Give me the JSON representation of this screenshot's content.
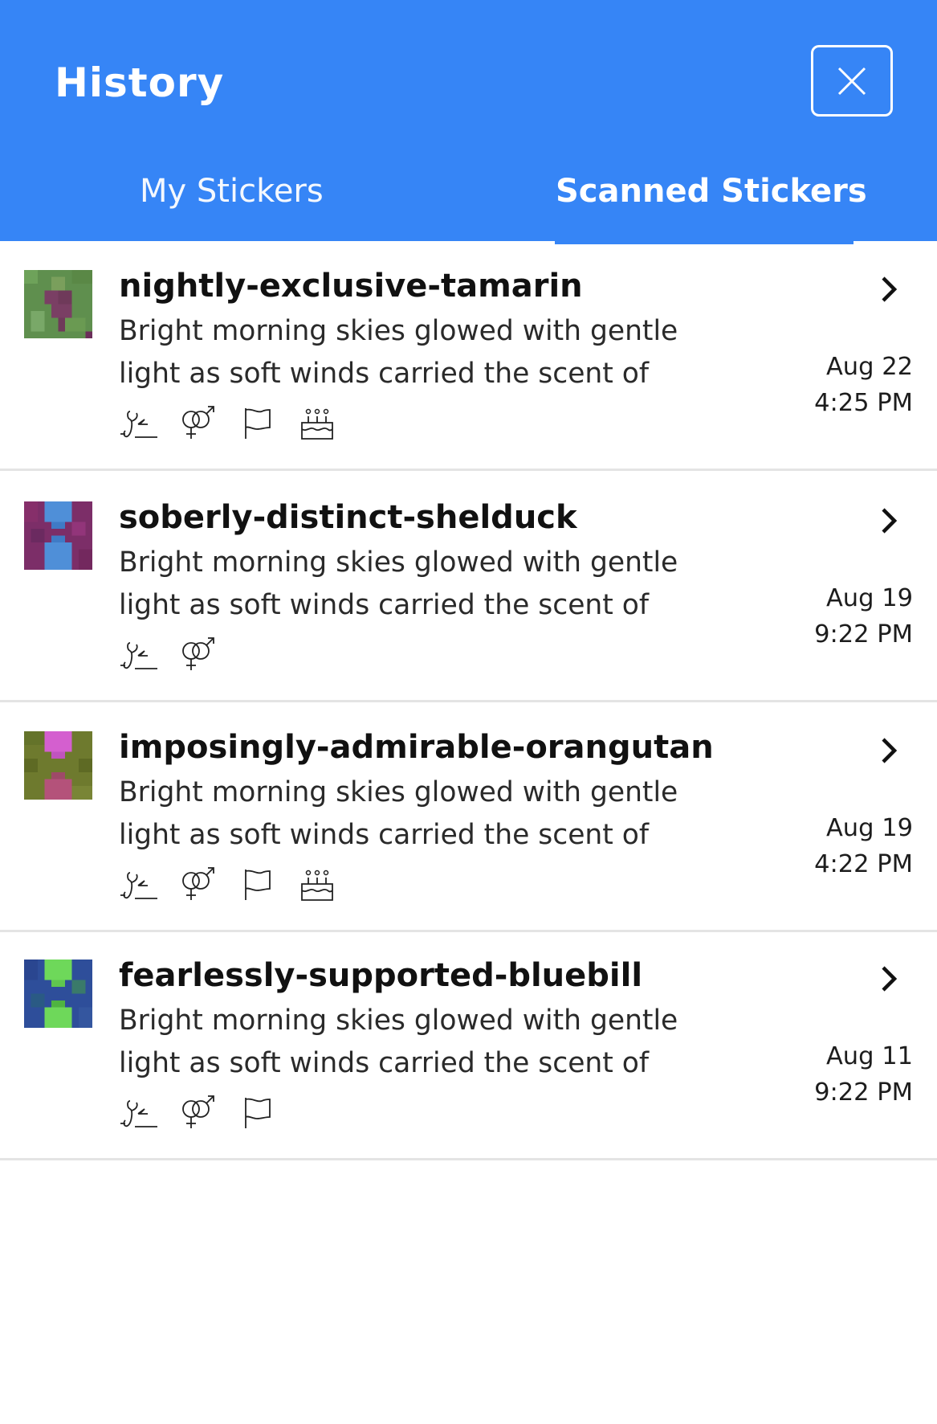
{
  "header": {
    "title": "History",
    "background": "#3685f6"
  },
  "tabs": [
    {
      "label": "My Stickers",
      "active": false
    },
    {
      "label": "Scanned Stickers",
      "active": true
    }
  ],
  "items": [
    {
      "name": "nightly-exclusive-tamarin",
      "description_line1": "Bright morning skies glowed with gentle",
      "description_line2": "light as soft winds carried the scent of",
      "date": "Aug 22",
      "time": "4:25 PM",
      "icons": [
        "signature-icon",
        "gender-icon",
        "flag-icon",
        "birthday-cake-icon"
      ],
      "thumb_colors": {
        "bg": "#5f8f4e",
        "fg": "#7a3f64"
      }
    },
    {
      "name": "soberly-distinct-shelduck",
      "description_line1": "Bright morning skies glowed with gentle",
      "description_line2": "light as soft winds carried the scent of",
      "date": "Aug 19",
      "time": "9:22 PM",
      "icons": [
        "signature-icon",
        "gender-icon"
      ],
      "thumb_colors": {
        "bg": "#7c2e68",
        "fg": "#4f8fd8"
      }
    },
    {
      "name": "imposingly-admirable-orangutan",
      "description_line1": "Bright morning skies glowed with gentle",
      "description_line2": "light as soft winds carried the scent of",
      "date": "Aug 19",
      "time": "4:22 PM",
      "icons": [
        "signature-icon",
        "gender-icon",
        "flag-icon",
        "birthday-cake-icon"
      ],
      "thumb_colors": {
        "bg": "#6e7a2e",
        "fg": "#d45fcf"
      }
    },
    {
      "name": "fearlessly-supported-bluebill",
      "description_line1": "Bright morning skies glowed with gentle",
      "description_line2": "light as soft winds carried the scent of",
      "date": "Aug 11",
      "time": "9:22 PM",
      "icons": [
        "signature-icon",
        "gender-icon",
        "flag-icon"
      ],
      "thumb_colors": {
        "bg": "#2e4e9a",
        "fg": "#6ed85a"
      }
    }
  ]
}
